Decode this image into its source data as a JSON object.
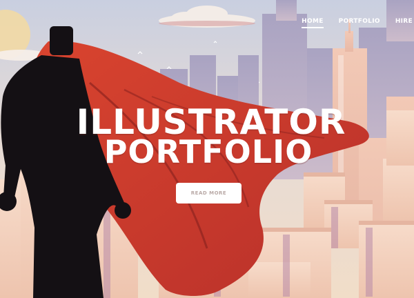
{
  "nav": {
    "items": [
      {
        "label": "HOME",
        "active": true
      },
      {
        "label": "PORTFOLIO",
        "active": false
      },
      {
        "label": "HIRE",
        "active": false
      }
    ]
  },
  "hero": {
    "title_line1": "ILLUSTRATOR",
    "title_line2": "PORTFOLIO",
    "cta_label": "READ MORE"
  },
  "colors": {
    "cape": "#c8382a",
    "silhouette": "#141014",
    "sky_top": "#c9cfe0",
    "sun": "#f2d9a4",
    "button_text": "#b9a9a6"
  }
}
